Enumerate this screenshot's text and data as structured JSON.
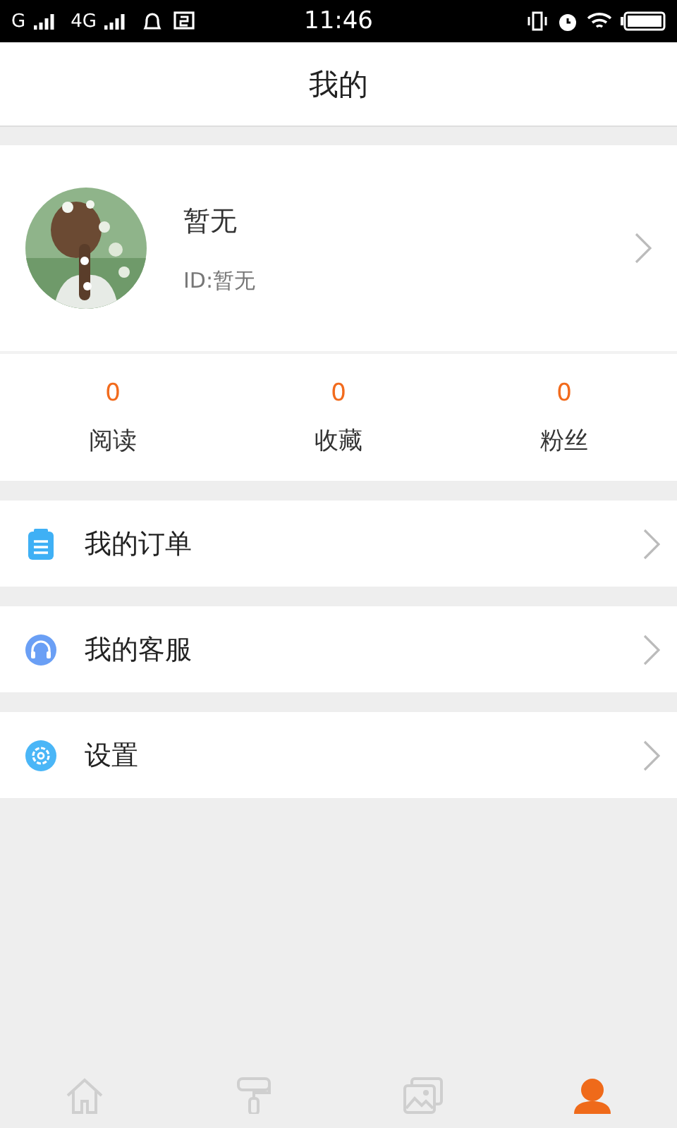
{
  "status_bar": {
    "network_1": "G",
    "network_2": "4G",
    "time": "11:46"
  },
  "header": {
    "title": "我的"
  },
  "profile": {
    "name": "暂无",
    "id": "ID:暂无"
  },
  "stats": [
    {
      "value": "0",
      "label": "阅读"
    },
    {
      "value": "0",
      "label": "收藏"
    },
    {
      "value": "0",
      "label": "粉丝"
    }
  ],
  "menu": [
    {
      "kind": "orders",
      "label": "我的订单"
    },
    {
      "kind": "service",
      "label": "我的客服"
    },
    {
      "kind": "settings",
      "label": "设置"
    }
  ],
  "tab_bar": [
    {
      "kind": "home",
      "selected": false
    },
    {
      "kind": "roller",
      "selected": false
    },
    {
      "kind": "gallery",
      "selected": false
    },
    {
      "kind": "person",
      "selected": true
    }
  ]
}
